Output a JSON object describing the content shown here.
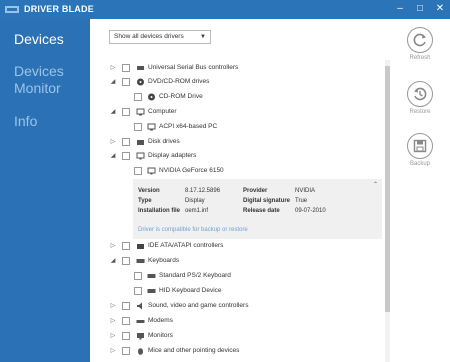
{
  "app": {
    "title": "DRIVER BLADE"
  },
  "window_controls": {
    "minimize": "–",
    "maximize": "□",
    "close": "✕"
  },
  "sidebar": {
    "items": [
      {
        "label": "Devices",
        "active": true
      },
      {
        "label": "Devices Monitor",
        "active": false
      },
      {
        "label": "Info",
        "active": false
      }
    ]
  },
  "filter": {
    "selected": "Show all devices drivers"
  },
  "tree": [
    {
      "label": "Universal Serial Bus controllers",
      "expanded": false,
      "icon": "usb-icon"
    },
    {
      "label": "DVD/CD-ROM drives",
      "expanded": true,
      "icon": "disc-drive-icon"
    },
    {
      "label": "CD-ROM Drive",
      "child": true,
      "icon": "disc-drive-icon"
    },
    {
      "label": "Computer",
      "expanded": true,
      "icon": "computer-icon"
    },
    {
      "label": "ACPI x64-based PC",
      "child": true,
      "icon": "computer-icon"
    },
    {
      "label": "Disk drives",
      "expanded": false,
      "icon": "disk-drive-icon"
    },
    {
      "label": "Display adapters",
      "expanded": true,
      "icon": "display-icon"
    },
    {
      "label": "NVIDIA GeForce 6150",
      "child": true,
      "icon": "display-icon"
    },
    {
      "label": "IDE ATA/ATAPI controllers",
      "expanded": false,
      "icon": "ide-controller-icon"
    },
    {
      "label": "Keyboards",
      "expanded": true,
      "icon": "keyboard-icon"
    },
    {
      "label": "Standard PS/2 Keyboard",
      "child": true,
      "icon": "keyboard-icon"
    },
    {
      "label": "HID Keyboard Device",
      "child": true,
      "icon": "keyboard-icon"
    },
    {
      "label": "Sound, video and game controllers",
      "expanded": false,
      "icon": "speaker-icon"
    },
    {
      "label": "Modems",
      "expanded": false,
      "icon": "modem-icon"
    },
    {
      "label": "Monitors",
      "expanded": false,
      "icon": "monitor-icon"
    },
    {
      "label": "Mice and other pointing devices",
      "expanded": false,
      "icon": "mouse-icon"
    }
  ],
  "details": {
    "version_label": "Version",
    "version": "8.17.12.5896",
    "type_label": "Type",
    "type": "Display",
    "file_label": "Installation file",
    "file": "oem1.inf",
    "provider_label": "Provider",
    "provider": "NVIDIA",
    "signature_label": "Digital signature",
    "signature": "True",
    "date_label": "Release date",
    "date": "09-07-2010",
    "note": "Driver is compatible for backup or restore"
  },
  "actions": {
    "refresh": "Refresh",
    "restore": "Restore",
    "backup": "Backup"
  },
  "colors": {
    "sidebar": "#2a72b5",
    "titlebar": "#2b74b8",
    "details_bg": "#f0f0f0",
    "note": "#6fa3d4"
  }
}
